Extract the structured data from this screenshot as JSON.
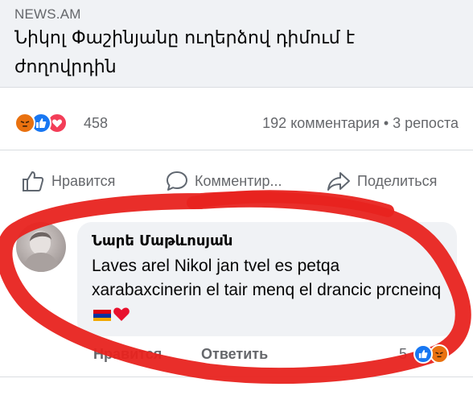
{
  "link_preview": {
    "source": "NEWS.AM",
    "headline": "Նիկոլ Փաշինյանը ուղերձով դիմում է ժողովրդին"
  },
  "post_stats": {
    "reactions_count": "458",
    "comments_shares": "192 комментария • 3 репоста",
    "reaction_icons": [
      "angry-icon",
      "like-icon",
      "love-icon"
    ]
  },
  "actions": {
    "like": "Нравится",
    "comment": "Комментир...",
    "share": "Поделиться"
  },
  "comment": {
    "author": "Նարե Մաթևոսյան",
    "text": "Laves arel Nikol jan tvel es petqa xarabaxcinerin el tair menq el drancic prcneinq",
    "emojis": [
      "armenian-flag-emoji",
      "red-heart-emoji"
    ],
    "like_label": "Нравится",
    "reply_label": "Ответить",
    "reactions_count": "5",
    "reaction_icons": [
      "like-icon",
      "angry-icon"
    ]
  },
  "colors": {
    "facebook_blue": "#1877f2",
    "angry_orange": "#e9710f",
    "love_red": "#f33e58",
    "secondary_text": "#65676b",
    "annotation_red": "#e8231f"
  }
}
